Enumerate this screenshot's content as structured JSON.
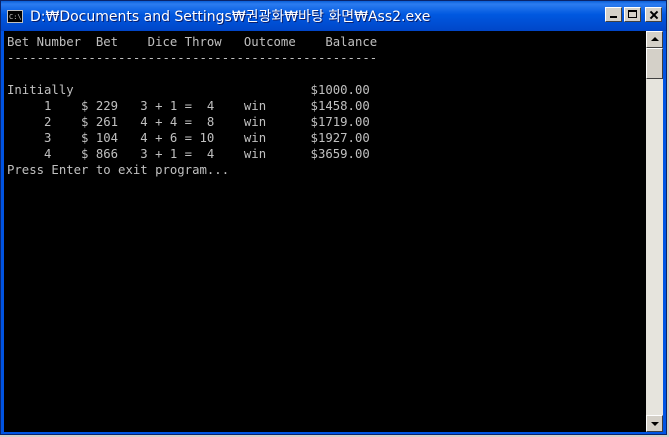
{
  "window": {
    "title": "D:₩Documents and Settings₩권광화₩바탕 화면₩Ass2.exe",
    "icon_label": "C:\\"
  },
  "console": {
    "lines": [
      "Bet Number  Bet    Dice Throw   Outcome    Balance",
      "--------------------------------------------------",
      "",
      "Initially                                $1000.00",
      "     1    $ 229   3 + 1 =  4    win      $1458.00",
      "     2    $ 261   4 + 4 =  8    win      $1719.00",
      "     3    $ 104   4 + 6 = 10    win      $1927.00",
      "     4    $ 866   3 + 1 =  4    win      $3659.00",
      "Press Enter to exit program..."
    ]
  },
  "colors": {
    "title_bar": "#0054e3",
    "console_bg": "#000000",
    "console_fg": "#c0c0c0"
  },
  "icons": [
    "console-app-icon",
    "minimize-icon",
    "maximize-icon",
    "close-icon",
    "scroll-up-icon",
    "scroll-down-icon"
  ]
}
